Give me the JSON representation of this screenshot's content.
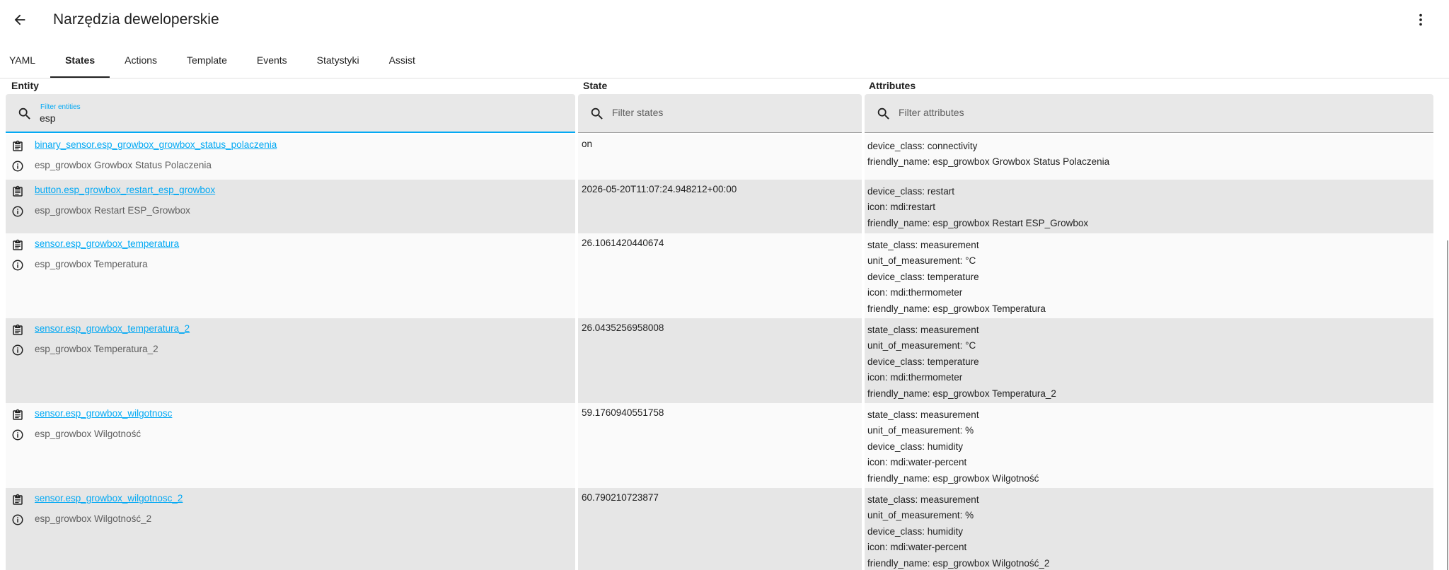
{
  "header": {
    "title": "Narzędzia deweloperskie",
    "back_icon": "arrow-left-icon",
    "menu_icon": "dots-vertical-icon"
  },
  "tabs": [
    {
      "label": "YAML",
      "active": false
    },
    {
      "label": "States",
      "active": true
    },
    {
      "label": "Actions",
      "active": false
    },
    {
      "label": "Template",
      "active": false
    },
    {
      "label": "Events",
      "active": false
    },
    {
      "label": "Statystyki",
      "active": false
    },
    {
      "label": "Assist",
      "active": false
    }
  ],
  "columns": {
    "entity": "Entity",
    "state": "State",
    "attributes": "Attributes"
  },
  "filters": {
    "entity_label": "Filter entities",
    "entity_value": "esp",
    "states_placeholder": "Filter states",
    "attributes_placeholder": "Filter attributes"
  },
  "colors": {
    "accent": "#03a9f4",
    "row_even": "#e6e6e6",
    "row_odd": "#fafafa"
  },
  "rows": [
    {
      "entity_id": "binary_sensor.esp_growbox_growbox_status_polaczenia",
      "friendly": "esp_growbox Growbox Status Polaczenia",
      "state": "on",
      "attributes": [
        "device_class: connectivity",
        "friendly_name: esp_growbox Growbox Status Polaczenia"
      ]
    },
    {
      "entity_id": "button.esp_growbox_restart_esp_growbox",
      "friendly": "esp_growbox Restart ESP_Growbox",
      "state": "2026-05-20T11:07:24.948212+00:00",
      "attributes": [
        "device_class: restart",
        "icon: mdi:restart",
        "friendly_name: esp_growbox Restart ESP_Growbox"
      ]
    },
    {
      "entity_id": "sensor.esp_growbox_temperatura",
      "friendly": "esp_growbox Temperatura",
      "state": "26.1061420440674",
      "attributes": [
        "state_class: measurement",
        "unit_of_measurement: °C",
        "device_class: temperature",
        "icon: mdi:thermometer",
        "friendly_name: esp_growbox Temperatura"
      ]
    },
    {
      "entity_id": "sensor.esp_growbox_temperatura_2",
      "friendly": "esp_growbox Temperatura_2",
      "state": "26.0435256958008",
      "attributes": [
        "state_class: measurement",
        "unit_of_measurement: °C",
        "device_class: temperature",
        "icon: mdi:thermometer",
        "friendly_name: esp_growbox Temperatura_2"
      ]
    },
    {
      "entity_id": "sensor.esp_growbox_wilgotnosc",
      "friendly": "esp_growbox Wilgotność",
      "state": "59.1760940551758",
      "attributes": [
        "state_class: measurement",
        "unit_of_measurement: %",
        "device_class: humidity",
        "icon: mdi:water-percent",
        "friendly_name: esp_growbox Wilgotność"
      ]
    },
    {
      "entity_id": "sensor.esp_growbox_wilgotnosc_2",
      "friendly": "esp_growbox Wilgotność_2",
      "state": "60.790210723877",
      "attributes": [
        "state_class: measurement",
        "unit_of_measurement: %",
        "device_class: humidity",
        "icon: mdi:water-percent",
        "friendly_name: esp_growbox Wilgotność_2"
      ]
    }
  ]
}
